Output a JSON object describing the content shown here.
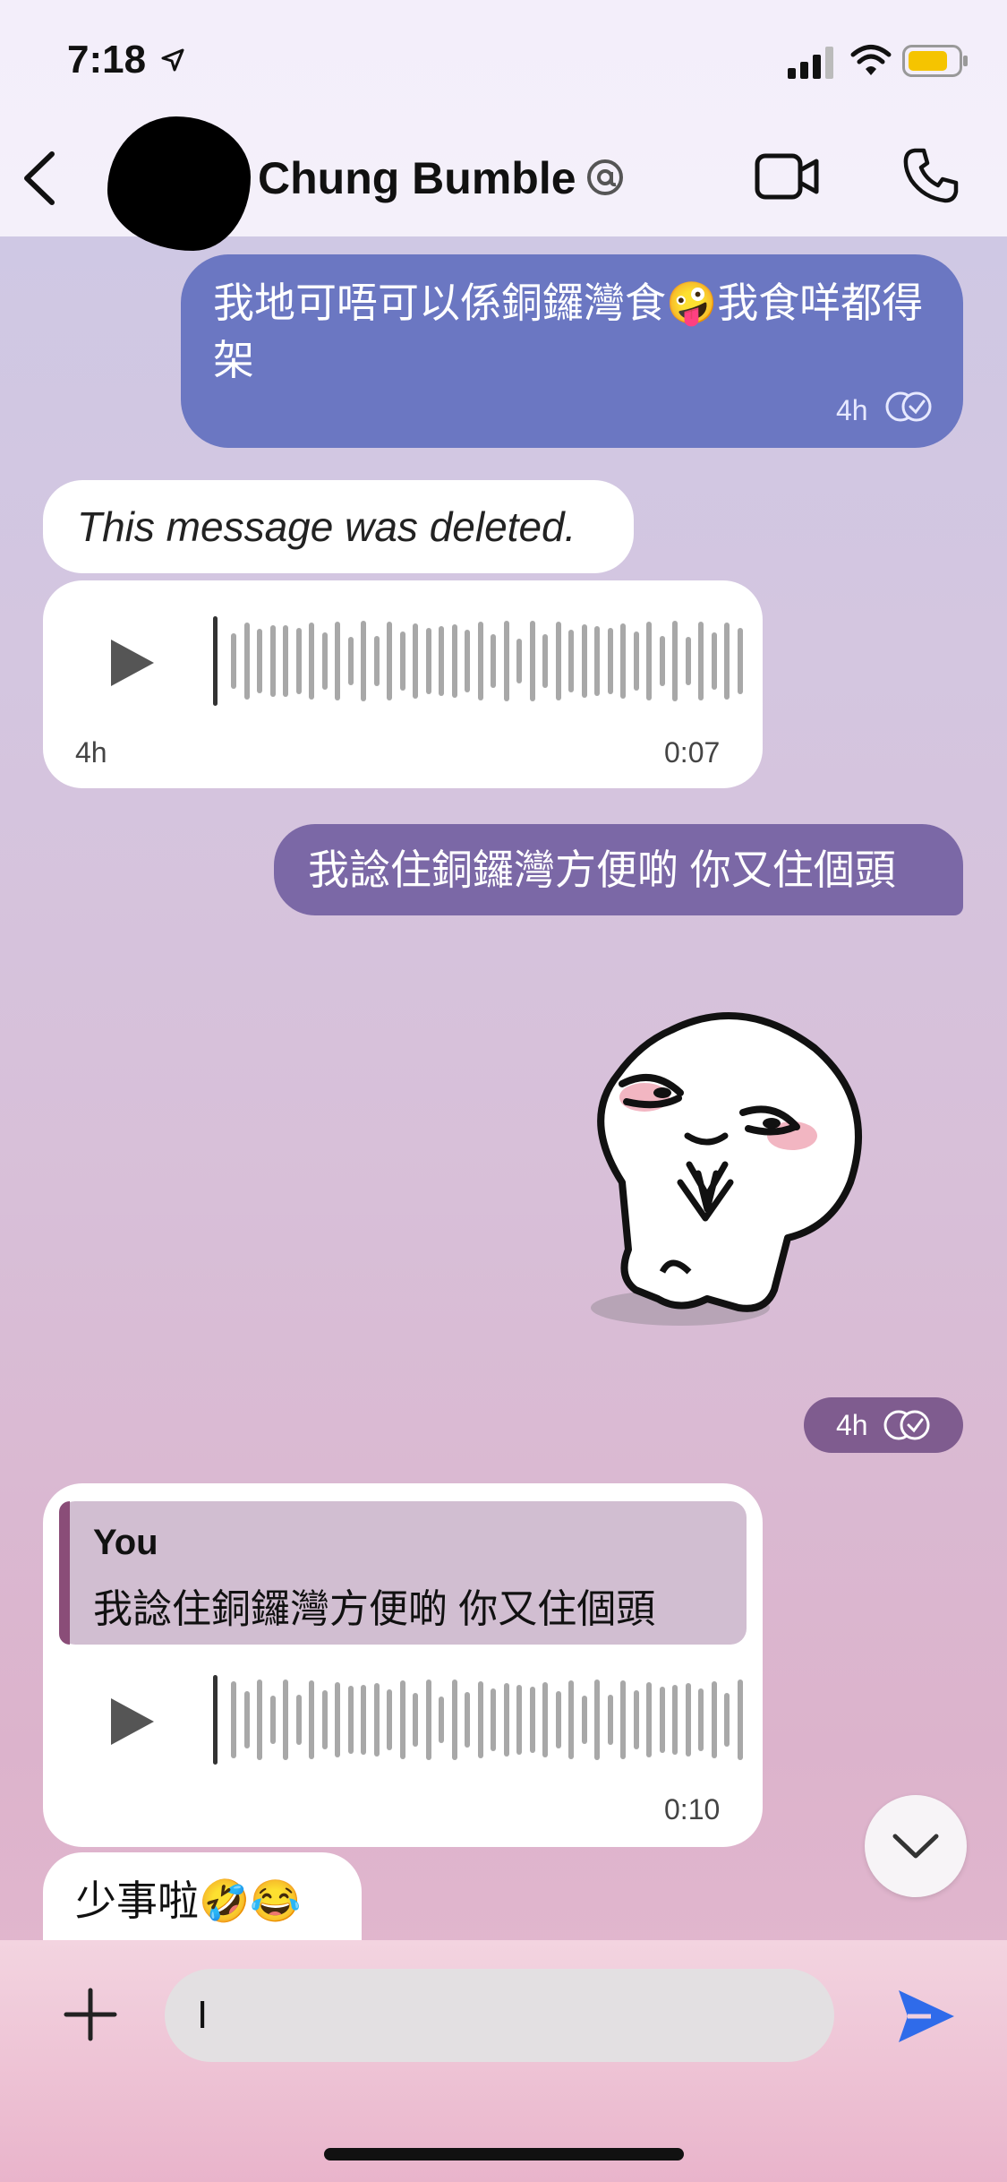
{
  "status": {
    "time": "7:18"
  },
  "header": {
    "contact_name": "Chung Bumble"
  },
  "messages": {
    "m1": {
      "text": "我地可唔可以係銅鑼灣食🤪我食咩都得架",
      "time": "4h"
    },
    "m2": {
      "text": "This message was deleted."
    },
    "m3": {
      "time": "4h",
      "duration": "0:07"
    },
    "m4": {
      "text": "我諗住銅鑼灣方便啲 你又住個頭"
    },
    "m5": {
      "time": "4h"
    },
    "m6": {
      "quote_author": "You",
      "quote_text": "我諗住銅鑼灣方便啲 你又住個頭",
      "duration": "0:10"
    },
    "m7": {
      "text": "少事啦🤣😂"
    }
  },
  "composer": {
    "value": "I"
  },
  "colors": {
    "outgoing_blue": "#6b77c2",
    "outgoing_purple": "#7b68a6",
    "send_blue": "#2f6bea"
  }
}
